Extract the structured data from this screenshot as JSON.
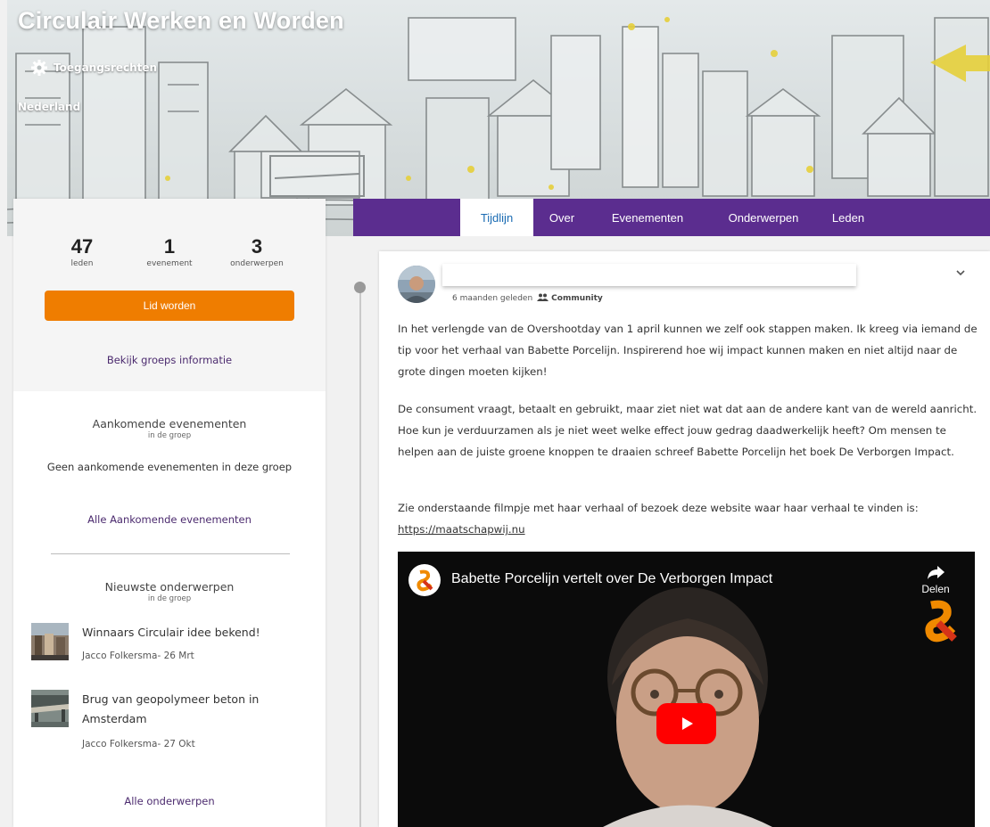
{
  "banner": {
    "title": "Circulair Werken en Worden",
    "access_label": "Toegangsrechten",
    "location": "Nederland"
  },
  "tabs": [
    {
      "label": "Tijdlijn",
      "active": true
    },
    {
      "label": "Over",
      "active": false
    },
    {
      "label": "Evenementen",
      "active": false
    },
    {
      "label": "Onderwerpen",
      "active": false
    },
    {
      "label": "Leden",
      "active": false
    }
  ],
  "stats": [
    {
      "value": "47",
      "label": "leden"
    },
    {
      "value": "1",
      "label": "evenement"
    },
    {
      "value": "3",
      "label": "onderwerpen"
    }
  ],
  "sidebar": {
    "join_label": "Lid worden",
    "group_info_link": "Bekijk groeps informatie",
    "events": {
      "title": "Aankomende evenementen",
      "subtitle": "in de groep",
      "empty_text": "Geen aankomende evenementen in deze groep",
      "all_link": "Alle Aankomende evenementen"
    },
    "topics": {
      "title": "Nieuwste onderwerpen",
      "subtitle": "in de groep",
      "items": [
        {
          "title": "Winnaars Circulair idee bekend!",
          "meta": "Jacco Folkersma- 26 Mrt"
        },
        {
          "title": "Brug van geopolymeer beton in Amsterdam",
          "meta": "Jacco Folkersma- 27 Okt"
        }
      ],
      "all_link": "Alle onderwerpen"
    }
  },
  "post": {
    "time": "6 maanden geleden",
    "audience": "Community",
    "paragraphs": [
      "In het verlengde van de Overshootday van 1 april kunnen we zelf ook stappen maken. Ik kreeg via iemand de tip voor het verhaal van Babette Porcelijn. Inspirerend hoe wij impact kunnen maken en niet altijd naar de grote dingen moeten kijken!",
      "De consument vraagt, betaalt en gebruikt, maar ziet niet wat dat aan de andere kant van de wereld aanricht. Hoe kun je verduurzamen als je niet weet welke effect jouw gedrag daadwerkelijk heeft? Om mensen te helpen aan de juiste groene knoppen te draaien schreef Babette Porcelijn het boek De Verborgen Impact.",
      "Zie onderstaande filmpje met haar verhaal of bezoek deze website waar haar verhaal te vinden is:"
    ],
    "link": "https://maatschapwij.nu",
    "video": {
      "title": "Babette Porcelijn vertelt over De Verborgen Impact",
      "share_label": "Delen"
    }
  },
  "colors": {
    "tab_bar": "#5b2d8f",
    "join_button": "#ef7d00",
    "link_purple": "#4b2a6e",
    "active_tab_text": "#1a6bb3",
    "youtube_red": "#ff0000"
  }
}
